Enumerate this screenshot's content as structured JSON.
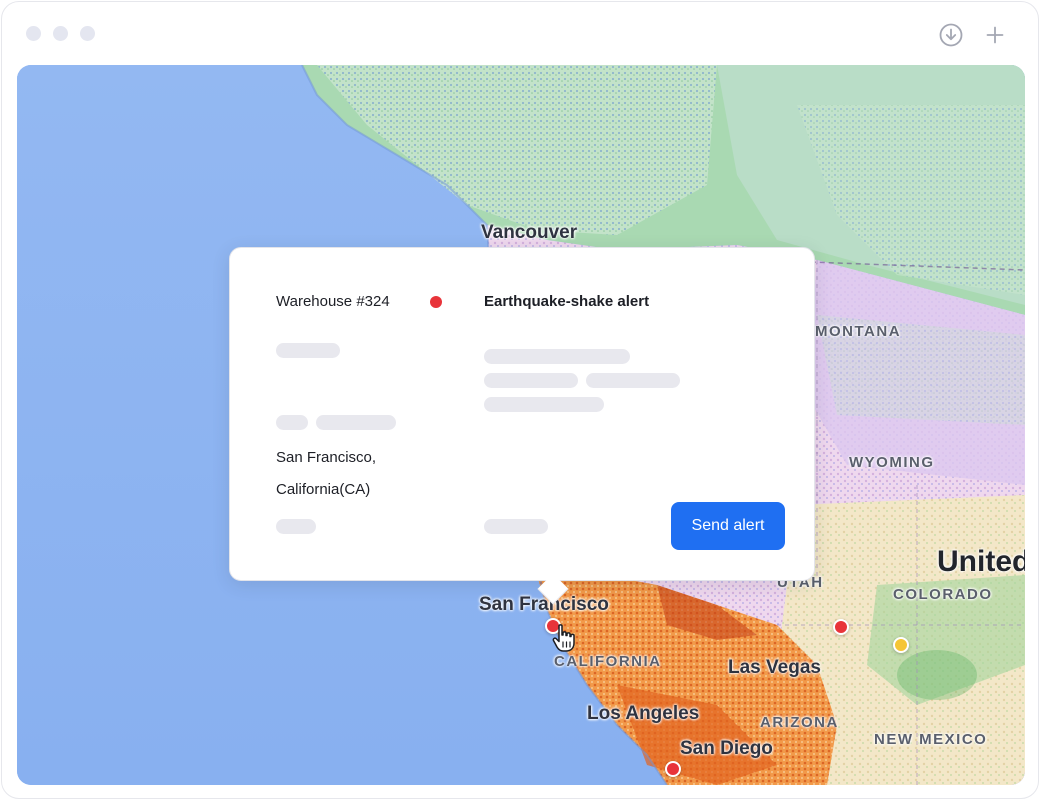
{
  "window": {
    "traffic_lights": [
      "close-dot",
      "minimize-dot",
      "zoom-dot"
    ],
    "download_icon": "download-circle-icon",
    "plus_icon": "plus-icon"
  },
  "map": {
    "cities": {
      "vancouver": "Vancouver",
      "san_francisco": "San Francisco",
      "las_vegas": "Las Vegas",
      "los_angeles": "Los Angeles",
      "san_diego": "San Diego"
    },
    "regions": {
      "montana": "MONTANA",
      "wyoming": "WYOMING",
      "utah": "UTAH",
      "colorado": "COLORADO",
      "california": "CALIFORNIA",
      "arizona": "ARIZONA",
      "new_mexico": "NEW MEXICO"
    },
    "country": "United",
    "markers": [
      {
        "name": "san-francisco-marker",
        "color": "#e8343a"
      },
      {
        "name": "utah-marker",
        "color": "#e8343a"
      },
      {
        "name": "colorado-marker",
        "color": "#f5c535"
      },
      {
        "name": "san-diego-marker",
        "color": "#e8343a"
      }
    ]
  },
  "popup": {
    "location_name": "Warehouse #324",
    "status_color": "#e8343a",
    "alert_title": "Earthquake-shake alert",
    "address_line1": "San Francisco,",
    "address_line2": "California(CA)",
    "send_button": "Send alert",
    "accent_color": "#1f6ff2"
  }
}
